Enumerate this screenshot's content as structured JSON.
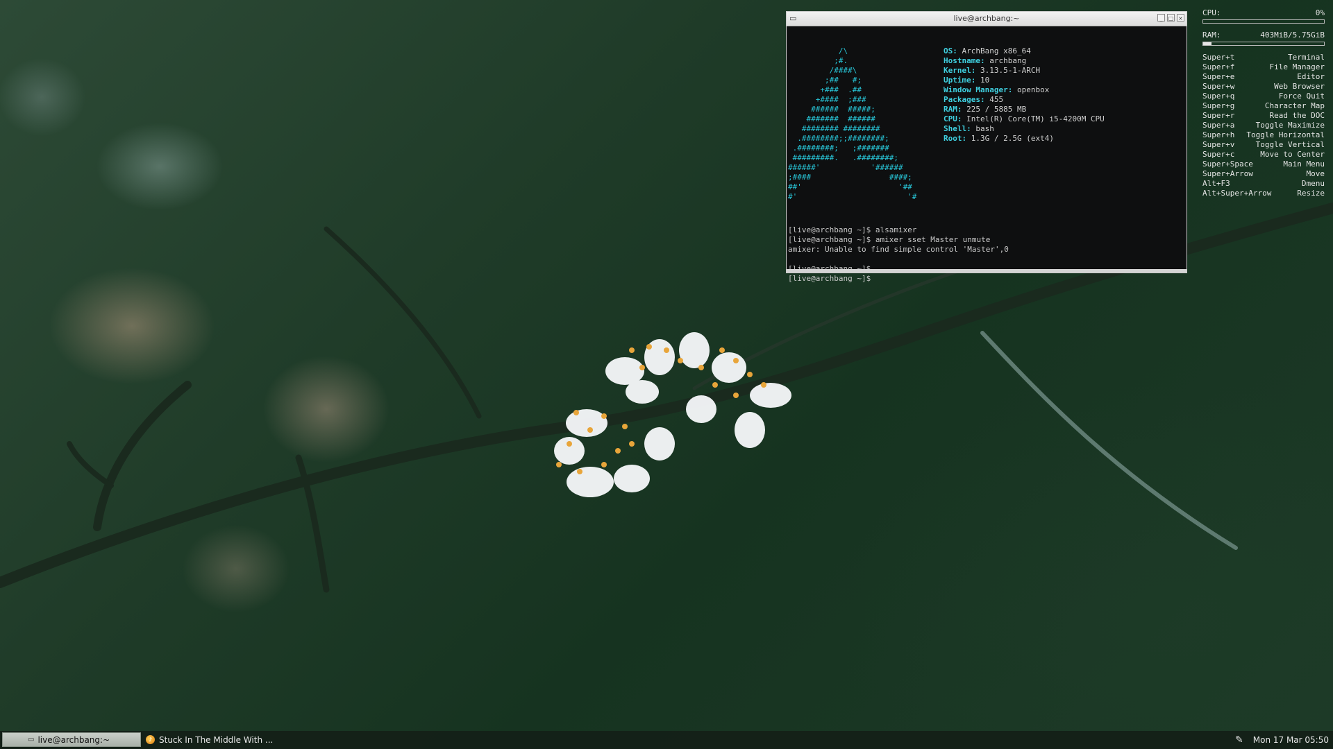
{
  "terminal": {
    "title": "live@archbang:~",
    "ascii_art": "           /\\\n          ;#.\n         /####\\\n        ;##   #;\n       +###  .##\n      +####  ;###\n     ######  #####;\n    #######  ######\n   ######## ########\n  .########;;########;\n .########;   ;#######\n #########.   .########;\n######'           '######\n;####                 ####;\n##'                     '##\n#'                        '#",
    "sysinfo": [
      {
        "key": "OS:",
        "value": "ArchBang x86_64"
      },
      {
        "key": "Hostname:",
        "value": "archbang"
      },
      {
        "key": "Kernel:",
        "value": "3.13.5-1-ARCH"
      },
      {
        "key": "Uptime:",
        "value": "10"
      },
      {
        "key": "Window Manager:",
        "value": "openbox"
      },
      {
        "key": "Packages:",
        "value": "455"
      },
      {
        "key": "RAM:",
        "value": "225 / 5885 MB"
      },
      {
        "key": "CPU:",
        "value": "Intel(R) Core(TM) i5-4200M CPU"
      },
      {
        "key": "Shell:",
        "value": "bash"
      },
      {
        "key": "Root:",
        "value": "1.3G / 2.5G (ext4)"
      }
    ],
    "lines": [
      "[live@archbang ~]$ alsamixer",
      "[live@archbang ~]$ amixer sset Master unmute",
      "amixer: Unable to find simple control 'Master',0",
      "",
      "[live@archbang ~]$",
      "[live@archbang ~]$"
    ]
  },
  "conky": {
    "cpu_label": "CPU:",
    "cpu_value": "0%",
    "cpu_fraction": 0.0,
    "ram_label": "RAM:",
    "ram_value": "403MiB/5.75GiB",
    "ram_fraction": 0.07,
    "shortcuts": [
      {
        "keys": "Super+t",
        "action": "Terminal"
      },
      {
        "keys": "Super+f",
        "action": "File Manager"
      },
      {
        "keys": "Super+e",
        "action": "Editor"
      },
      {
        "keys": "Super+w",
        "action": "Web Browser"
      },
      {
        "keys": "Super+q",
        "action": "Force Quit"
      },
      {
        "keys": "Super+g",
        "action": "Character Map"
      },
      {
        "keys": "Super+r",
        "action": "Read the DOC"
      },
      {
        "keys": "Super+a",
        "action": "Toggle Maximize"
      },
      {
        "keys": "Super+h",
        "action": "Toggle Horizontal"
      },
      {
        "keys": "Super+v",
        "action": "Toggle Vertical"
      },
      {
        "keys": "Super+c",
        "action": "Move to Center"
      },
      {
        "keys": "Super+Space",
        "action": "Main Menu"
      },
      {
        "keys": "Super+Arrow",
        "action": "Move"
      },
      {
        "keys": "Alt+F3",
        "action": "Dmenu"
      },
      {
        "keys": "Alt+Super+Arrow",
        "action": "Resize"
      }
    ]
  },
  "taskbar": {
    "terminal_task": "live@archbang:~",
    "music_task": "Stuck In The Middle With ...",
    "clock": "Mon 17 Mar 05:50"
  },
  "icons": {
    "terminal": "terminal-icon",
    "music": "music-player-icon",
    "tray": "pen-icon"
  }
}
